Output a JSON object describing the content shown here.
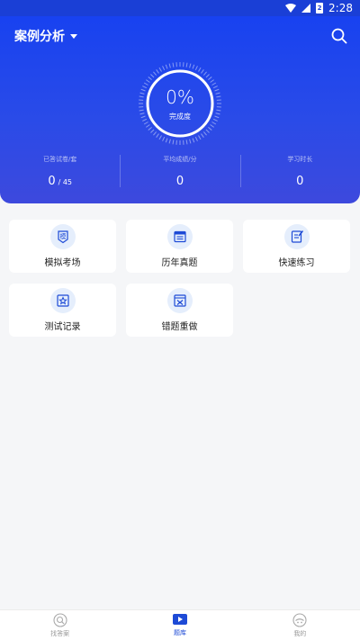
{
  "status_bar": {
    "time": "2:28",
    "battery_level": "2"
  },
  "header": {
    "subject_label": "案例分析"
  },
  "progress": {
    "percent_text": "0%",
    "caption": "完成度",
    "value": 0
  },
  "stats": [
    {
      "label": "已答试卷/套",
      "value": "0",
      "sub": "/ 45"
    },
    {
      "label": "平均成绩/分",
      "value": "0",
      "sub": ""
    },
    {
      "label": "学习时长",
      "value": "0",
      "sub": ""
    }
  ],
  "features": [
    {
      "label": "模拟考场",
      "icon": "mock-exam-icon"
    },
    {
      "label": "历年真题",
      "icon": "past-papers-icon"
    },
    {
      "label": "快速练习",
      "icon": "quick-practice-icon"
    },
    {
      "label": "测试记录",
      "icon": "test-record-icon"
    },
    {
      "label": "错题重做",
      "icon": "wrong-redo-icon"
    }
  ],
  "tabs": [
    {
      "label": "找答案",
      "icon": "find-answer-icon",
      "active": false
    },
    {
      "label": "题库",
      "icon": "question-bank-icon",
      "active": true
    },
    {
      "label": "我的",
      "icon": "profile-icon",
      "active": false
    }
  ],
  "colors": {
    "primary": "#1842f0",
    "active_tab": "#1d4ad6",
    "icon_bg": "#e5eefc",
    "icon_stroke": "#1d4ad6"
  }
}
